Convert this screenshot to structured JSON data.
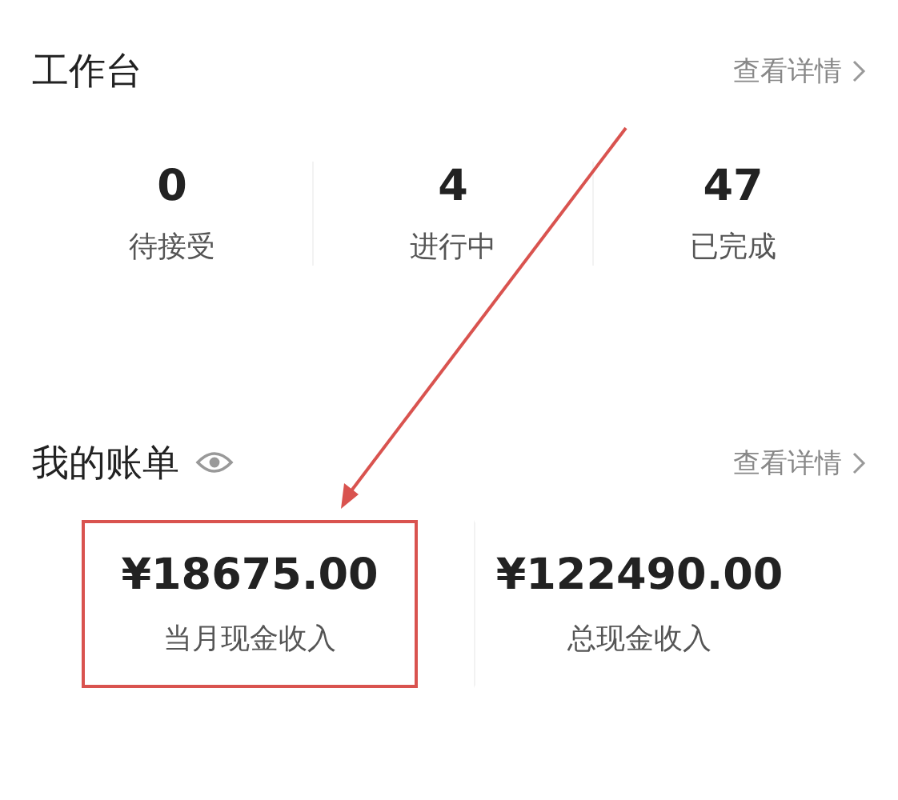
{
  "workbench": {
    "title": "工作台",
    "link": "查看详情",
    "stats": [
      {
        "value": "0",
        "label": "待接受"
      },
      {
        "value": "4",
        "label": "进行中"
      },
      {
        "value": "47",
        "label": "已完成"
      }
    ]
  },
  "bills": {
    "title": "我的账单",
    "link": "查看详情",
    "items": [
      {
        "amount": "¥18675.00",
        "label": "当月现金收入",
        "highlighted": true
      },
      {
        "amount": "¥122490.00",
        "label": "总现金收入",
        "highlighted": false
      }
    ]
  }
}
